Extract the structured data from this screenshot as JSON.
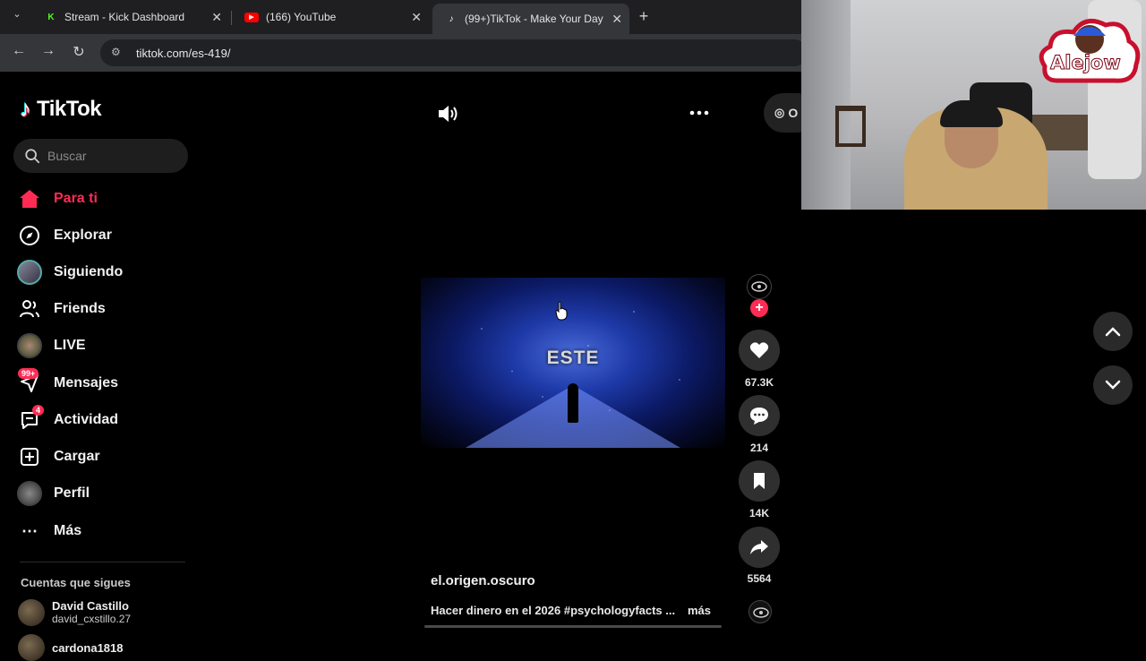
{
  "browser": {
    "tabs": [
      {
        "title": "Stream - Kick Dashboard",
        "favicon": "kick-icon",
        "color": "#53fc18"
      },
      {
        "title": "(166) YouTube",
        "favicon": "youtube-icon",
        "color": "#ff0000"
      },
      {
        "title": "(99+)TikTok - Make Your Day",
        "favicon": "tiktok-icon",
        "color": "#ffffff",
        "active": true
      }
    ],
    "url": "tiktok.com/es-419/"
  },
  "sidebar": {
    "logo_text": "TikTok",
    "search_placeholder": "Buscar",
    "items": [
      {
        "label": "Para ti",
        "icon": "home-icon",
        "active": true
      },
      {
        "label": "Explorar",
        "icon": "compass-icon"
      },
      {
        "label": "Siguiendo",
        "icon": "avatar"
      },
      {
        "label": "Friends",
        "icon": "friends-icon"
      },
      {
        "label": "LIVE",
        "icon": "avatar"
      },
      {
        "label": "Mensajes",
        "icon": "message-icon",
        "badge": "99+"
      },
      {
        "label": "Actividad",
        "icon": "activity-icon",
        "badge": "4"
      },
      {
        "label": "Cargar",
        "icon": "upload-icon"
      },
      {
        "label": "Perfil",
        "icon": "avatar"
      },
      {
        "label": "Más",
        "icon": "ellipsis-icon"
      }
    ],
    "following_title": "Cuentas que sigues",
    "accounts": [
      {
        "name": "David Castillo",
        "handle": "david_cxstillo.27"
      },
      {
        "name": "cardona1818",
        "handle": ""
      }
    ]
  },
  "video": {
    "overlay_text": "ESTE",
    "author": "el.origen.oscuro",
    "caption": "Hacer dinero en el 2026 #psychologyfacts ...",
    "more_label": "más",
    "likes": "67.3K",
    "comments": "214",
    "saves": "14K",
    "shares": "5564",
    "get_app_label": "O"
  },
  "webcam": {
    "overlay_logo_text": "Alejow"
  },
  "colors": {
    "accent": "#fe2c55",
    "background": "#000000"
  }
}
